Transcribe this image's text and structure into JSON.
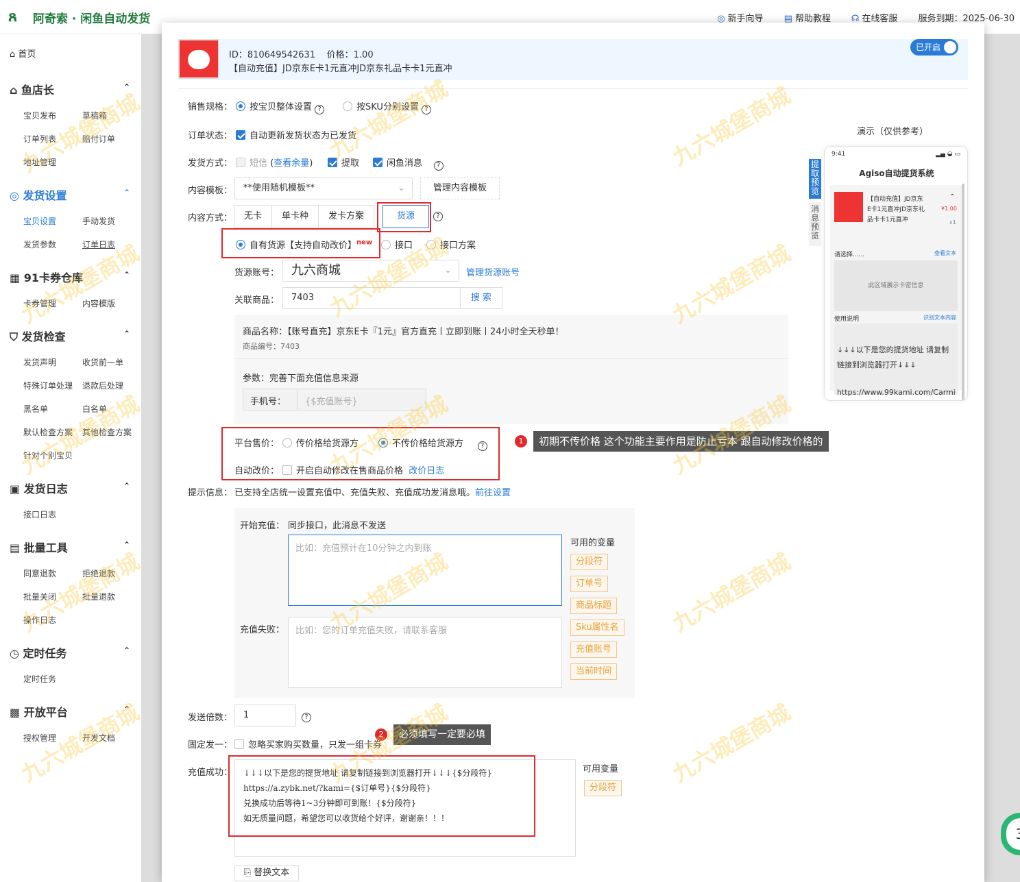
{
  "app": {
    "title": "阿奇索 · 闲鱼自动发货"
  },
  "topnav": {
    "guide": "新手向导",
    "help": "帮助教程",
    "service": "在线客服",
    "expire": "服务到期：2025-06-30"
  },
  "sidebar": {
    "home": "首页",
    "groups": [
      {
        "label": "鱼店长",
        "items": [
          "宝贝发布",
          "草稿箱",
          "订单列表",
          "赔付订单",
          "地址管理"
        ]
      },
      {
        "label": "发货设置",
        "items": [
          "宝贝设置",
          "手动发货",
          "发货参数",
          "订单日志"
        ]
      },
      {
        "label": "91卡券仓库",
        "items": [
          "卡券管理",
          "内容模版"
        ]
      },
      {
        "label": "发货检查",
        "items": [
          "发货声明",
          "收货前一单",
          "特殊订单处理",
          "退款后处理",
          "黑名单",
          "白名单",
          "默认检查方案",
          "其他检查方案",
          "针对个别宝贝"
        ]
      },
      {
        "label": "发货日志",
        "items": [
          "接口日志"
        ]
      },
      {
        "label": "批量工具",
        "items": [
          "同意退款",
          "拒绝退款",
          "批量关闭",
          "批量退款",
          "操作日志"
        ]
      },
      {
        "label": "定时任务",
        "items": [
          "定时任务"
        ]
      },
      {
        "label": "开放平台",
        "items": [
          "授权管理",
          "开发文档"
        ]
      }
    ]
  },
  "product": {
    "id_line": "ID：810649542631",
    "price_line": "价格：1.00",
    "title": "【自动充值】JD京东E卡1元直冲JD京东礼品卡卡1元直冲",
    "toggle": "已开启"
  },
  "form": {
    "spec_label": "销售规格：",
    "spec_opt1": "按宝贝整体设置",
    "spec_opt2": "按SKU分别设置",
    "order_label": "订单状态：",
    "order_opt": "自动更新发货状态为已发货",
    "ship_label": "发货方式：",
    "ship_sms": "短信",
    "ship_check": "查看余量",
    "ship_pick": "提取",
    "ship_msg": "闲鱼消息",
    "tpl_label": "内容模板：",
    "tpl_value": "**使用随机模板**",
    "tpl_manage": "管理内容模板",
    "mode_label": "内容方式：",
    "modes": [
      "无卡",
      "单卡种",
      "发卡方案",
      "货源"
    ],
    "src_own": "自有货源【支持自动改价】",
    "src_new": "new",
    "src_api": "接口",
    "src_plan": "接口方案",
    "acct_label": "货源账号：",
    "acct_value": "九六商城",
    "acct_manage": "管理货源账号",
    "goods_label": "关联商品：",
    "goods_value": "7403",
    "search": "搜 索",
    "goods_name": "商品名称：【账号直充】京东E卡『1元』官方直充丨立即到账丨24小时全天秒单！",
    "goods_no": "商品编号：7403",
    "param_title": "参数：完善下面充值信息来源",
    "phone_label": "手机号：",
    "phone_ph": "{$充值账号}",
    "price_label": "平台售价：",
    "price_opt1": "传价格给货源方",
    "price_opt2": "不传价格给货源方",
    "auto_label": "自动改价：",
    "auto_opt": "开启自动修改在售商品价格",
    "auto_log": "改价日志",
    "hint_label": "提示信息：",
    "hint_text": "已支持全店统一设置充值中、充值失败、充值成功发消息哦。",
    "hint_link": "前往设置",
    "start_label": "开始充值：",
    "start_text": "同步接口，此消息不发送",
    "start_ph": "比如：充值预计在10分钟之内到账",
    "fail_label": "充值失败：",
    "fail_ph": "比如：您的订单充值失败，请联系客服",
    "vars_title": "可用的变量",
    "vars": [
      "分段符",
      "订单号",
      "商品标题",
      "Sku属性名",
      "充值账号",
      "当前时间"
    ],
    "mult_label": "发送倍数：",
    "mult_value": "1",
    "fixed_label": "固定发一：",
    "fixed_opt": "忽略买家购买数量，只发一组卡券",
    "succ_label": "充值成功：",
    "succ_lines": [
      "↓↓↓以下是您的提货地址 请复制链接到浏览器打开↓↓↓{$分段符}",
      "https://a.zybk.net/?kami={$订单号}{$分段符}",
      "兑换成功后等待1~3分钟即可到账！{$分段符}",
      "如无质量问题，希望您可以收货给个好评，谢谢亲！！！"
    ],
    "succ_vars_title": "可用变量",
    "succ_var": "分段符",
    "replace_btn": "替换文本"
  },
  "tips": {
    "tip1_num": "1",
    "tip1": "初期不传价格 这个功能主要作用是防止亏本 跟自动修改价格的",
    "tip2_num": "2",
    "tip2": "必须填写一定要必填"
  },
  "preview": {
    "title": "演示（仅供参考）",
    "tab1": "提取预览",
    "tab2": "消息预览",
    "time": "9:41",
    "app": "Agiso自动提货系统",
    "item": "【自动充值】JD京东E卡1元直冲JD京东礼品卡卡1元直冲",
    "item_price": "¥1.00",
    "item_qty": "x1",
    "choose": "请选择......",
    "view_text": "查看文本",
    "card_area": "此区域展示卡密信息",
    "usage": "使用说明",
    "copy_text": "识别文本内容",
    "msg1": "↓↓↓以下是您的提货地址 请复制链接到浏览器打开↓↓↓",
    "msg2": "https://www.99kami.com/Carmi"
  },
  "watermark": "九六城堡商城",
  "colors": {
    "accent": "#2a7bd6",
    "brand": "#1e7a3a",
    "highlight": "#e0292b",
    "tag": "#e6a23c"
  }
}
